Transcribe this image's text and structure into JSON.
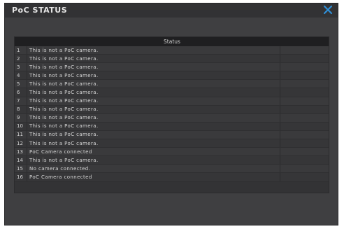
{
  "window": {
    "title": "PoC STATUS"
  },
  "table": {
    "header": "Status",
    "rows": [
      {
        "index": "1",
        "status": "This is not a PoC camera."
      },
      {
        "index": "2",
        "status": "This is not a PoC camera."
      },
      {
        "index": "3",
        "status": "This is not a PoC camera."
      },
      {
        "index": "4",
        "status": "This is not a PoC camera."
      },
      {
        "index": "5",
        "status": "This is not a PoC camera."
      },
      {
        "index": "6",
        "status": "This is not a PoC camera."
      },
      {
        "index": "7",
        "status": "This is not a PoC camera."
      },
      {
        "index": "8",
        "status": "This is not a PoC camera."
      },
      {
        "index": "9",
        "status": "This is not a PoC camera."
      },
      {
        "index": "10",
        "status": "This is not a PoC camera."
      },
      {
        "index": "11",
        "status": "This is not a PoC camera."
      },
      {
        "index": "12",
        "status": "This is not a PoC camera."
      },
      {
        "index": "13",
        "status": "PoC Camera connected"
      },
      {
        "index": "14",
        "status": "This is not a PoC camera."
      },
      {
        "index": "15",
        "status": "No camera connected."
      },
      {
        "index": "16",
        "status": "PoC Camera connected"
      }
    ]
  },
  "colors": {
    "close_icon": "#2f8fd8",
    "background": "#3f3f41"
  },
  "icons": {
    "close": "close-icon"
  }
}
